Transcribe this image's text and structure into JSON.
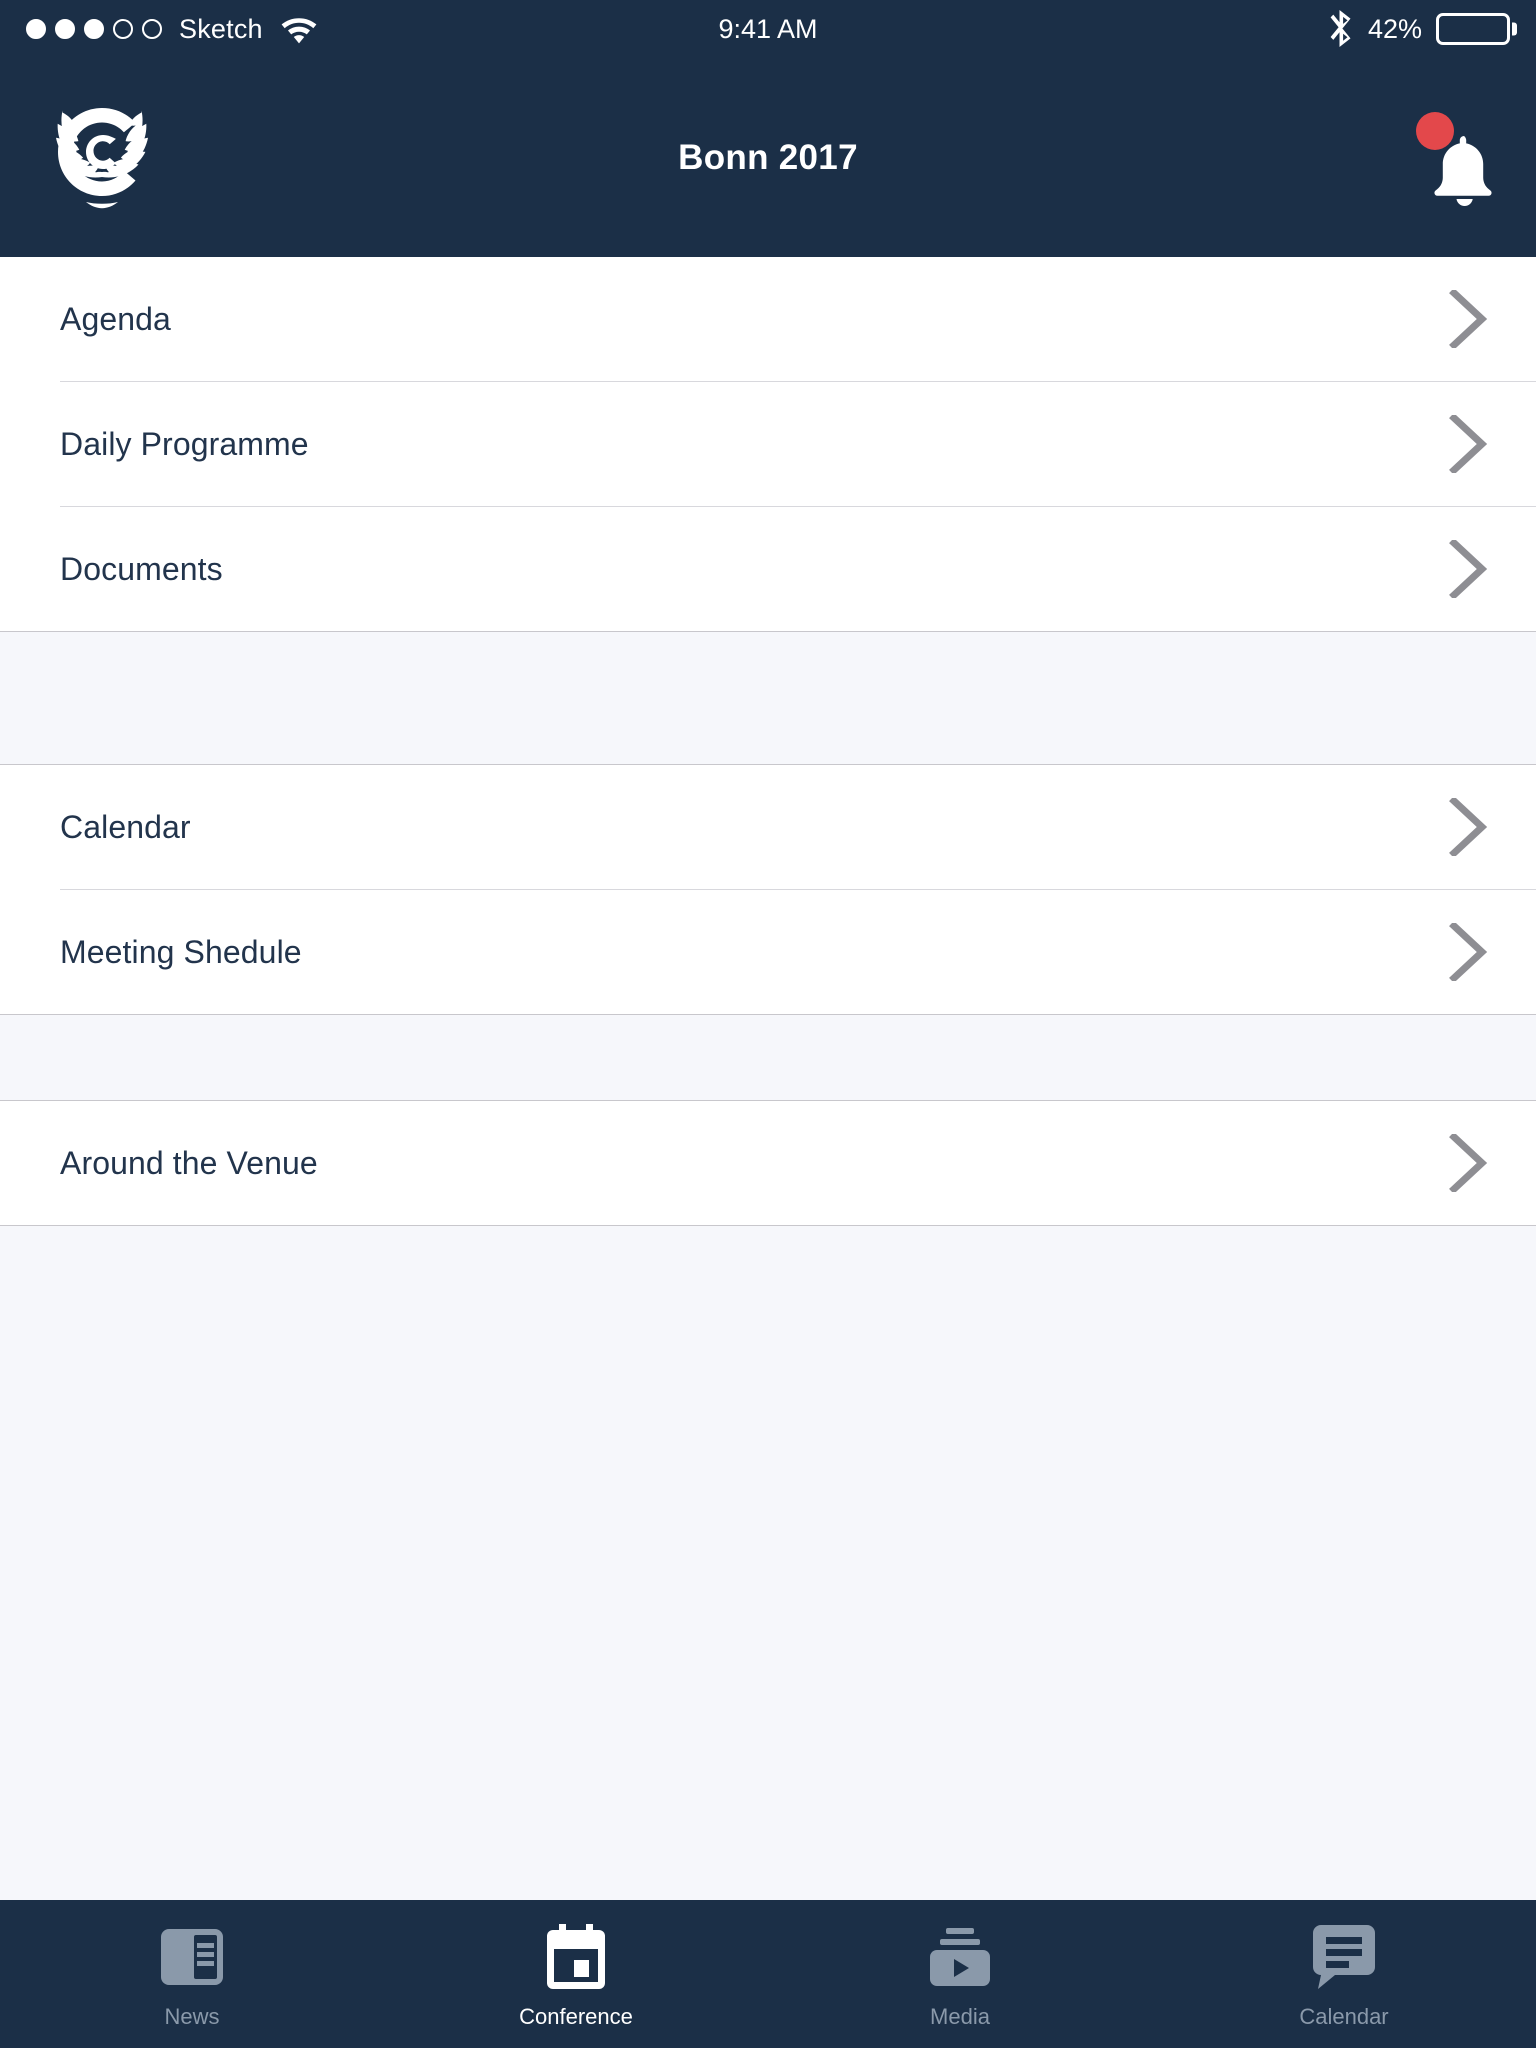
{
  "status_bar": {
    "carrier": "Sketch",
    "signal_dots_total": 5,
    "signal_dots_filled": 3,
    "wifi_icon": "wifi-icon",
    "time": "9:41 AM",
    "bluetooth_icon": "bluetooth-icon",
    "battery_percent_label": "42%",
    "battery_level": 42
  },
  "nav_bar": {
    "logo_icon": "unfccc-logo-icon",
    "title": "Bonn 2017",
    "bell_icon": "bell-icon",
    "has_notification_badge": true
  },
  "menu": {
    "groups": [
      {
        "id": "group-conference-info",
        "items": [
          {
            "label": "Agenda",
            "chevron": "chevron-right-icon"
          },
          {
            "label": "Daily Programme",
            "chevron": "chevron-right-icon"
          },
          {
            "label": "Documents",
            "chevron": "chevron-right-icon"
          }
        ]
      },
      {
        "id": "group-schedule",
        "items": [
          {
            "label": "Calendar",
            "chevron": "chevron-right-icon"
          },
          {
            "label": "Meeting Shedule",
            "chevron": "chevron-right-icon"
          }
        ]
      },
      {
        "id": "group-venue",
        "items": [
          {
            "label": "Around the Venue",
            "chevron": "chevron-right-icon"
          }
        ]
      }
    ]
  },
  "tab_bar": {
    "tabs": [
      {
        "label": "News",
        "icon": "news-icon",
        "active": false
      },
      {
        "label": "Conference",
        "icon": "calendar-icon",
        "active": true
      },
      {
        "label": "Media",
        "icon": "media-play-icon",
        "active": false
      },
      {
        "label": "Calendar",
        "icon": "chat-bubble-icon",
        "active": false
      }
    ]
  },
  "colors": {
    "navy": "#1B2F47",
    "badge_red": "#E3484B",
    "page_background": "#F6F7FB",
    "row_background": "#FFFFFF",
    "text_primary": "#22344C",
    "tab_inactive": "#8A99AA",
    "chevron_gray": "#8E8E93"
  }
}
